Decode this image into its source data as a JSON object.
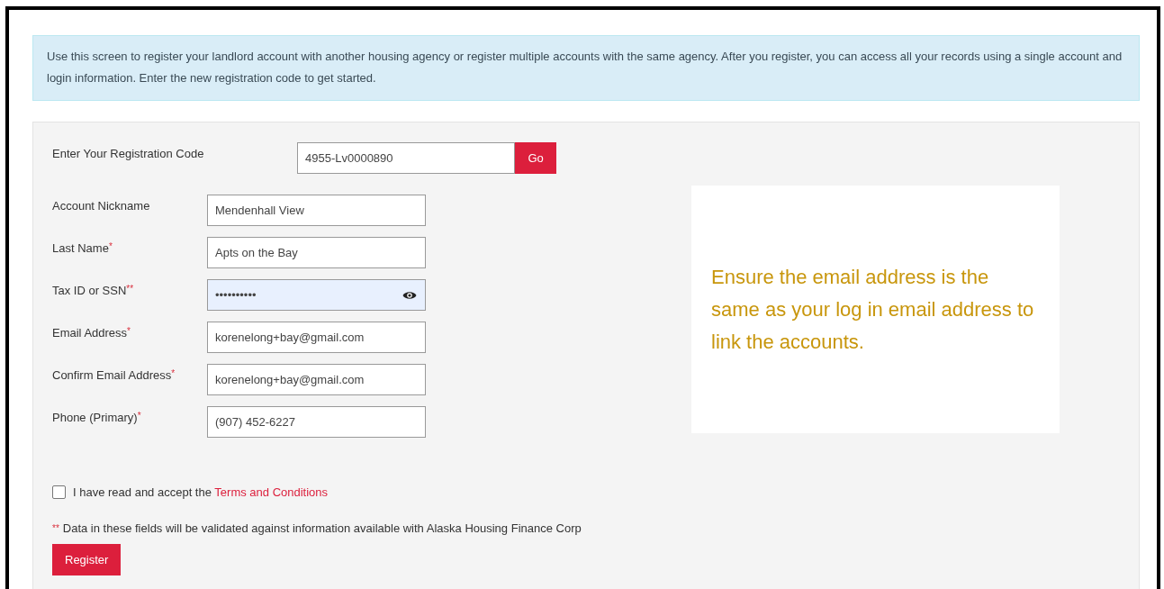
{
  "info": "Use this screen to register your landlord account with another housing agency or register multiple accounts with the same agency. After you register, you can access all your records using a single account and login information. Enter the new registration code to get started.",
  "registration": {
    "label": "Enter Your Registration Code",
    "value": "4955-Lv0000890",
    "button": "Go"
  },
  "fields": [
    {
      "label": "Account Nickname",
      "kind": "text",
      "value": "Mendenhall View",
      "focused": false
    },
    {
      "label": "Last Name",
      "marker": "*",
      "kind": "text",
      "value": "Apts on the Bay",
      "focused": false
    },
    {
      "label": "Tax ID or SSN",
      "marker": "**",
      "kind": "password",
      "value": "••••••••••",
      "focused": true
    },
    {
      "label": "Email Address",
      "marker": "*",
      "kind": "text",
      "value": "korenelong+bay@gmail.com",
      "focused": false
    },
    {
      "label": "Confirm Email Address",
      "marker": "*",
      "kind": "text",
      "value": "korenelong+bay@gmail.com",
      "focused": false
    },
    {
      "label": "Phone (Primary)",
      "marker": "*",
      "kind": "text",
      "value": "(907) 452-6227",
      "focused": false
    }
  ],
  "note": "Ensure the email address is the same as your log in email address to link the accounts.",
  "terms": {
    "checked": false,
    "text": "I have read and accept the",
    "link": "Terms and Conditions"
  },
  "validation": {
    "marker": "**",
    "text": "Data in these fields will be validated against information available with Alaska Housing Finance Corp"
  },
  "register_button": "Register"
}
